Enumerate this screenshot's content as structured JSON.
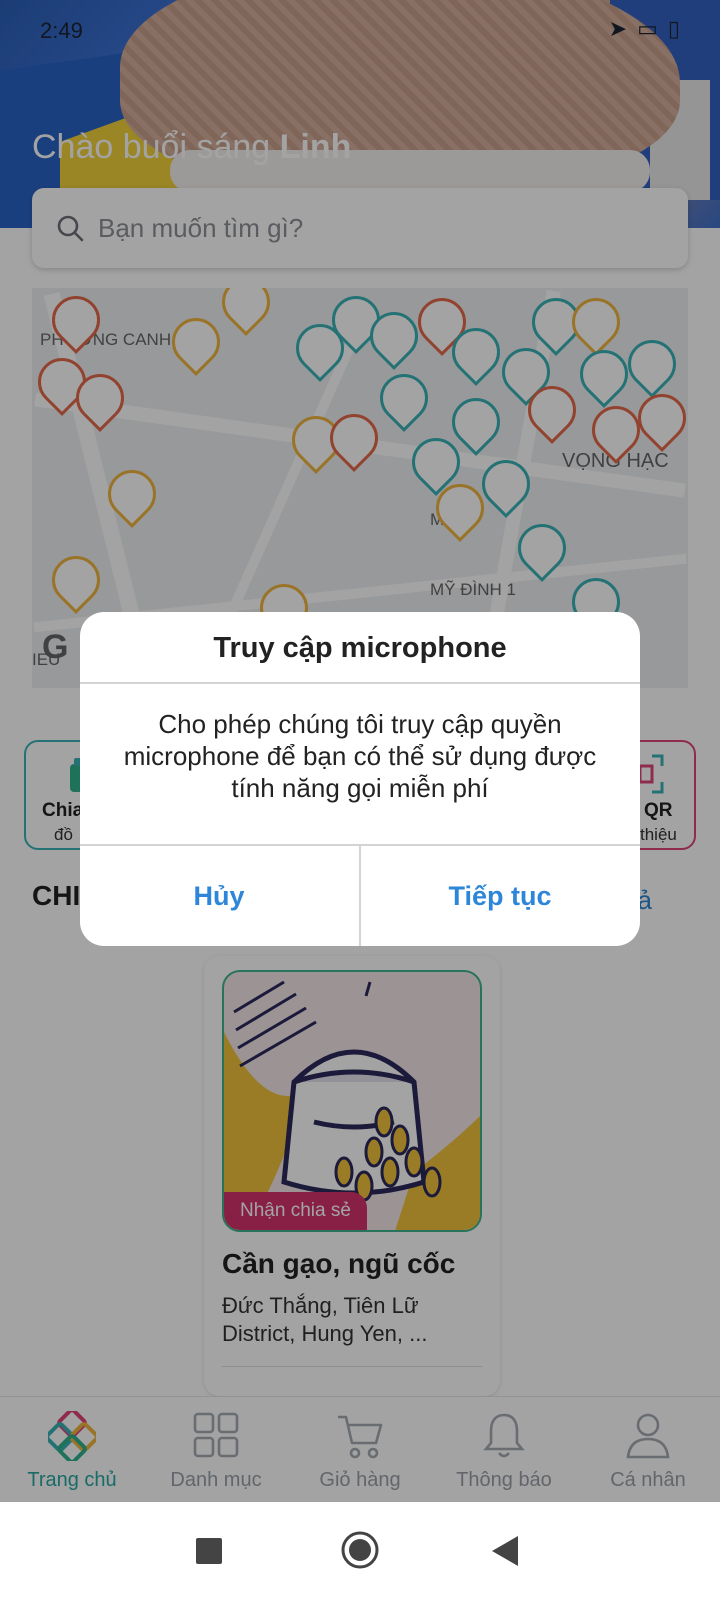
{
  "status_bar": {
    "time": "2:49",
    "icons": [
      "navigation-icon",
      "screen-icon",
      "signal-icon",
      "battery-icon"
    ]
  },
  "header": {
    "greeting_prefix": "Chào buổi sáng",
    "user_name": "Linh"
  },
  "search": {
    "placeholder": "Bạn muốn tìm gì?"
  },
  "map": {
    "labels": [
      "PHƯỜNG CANH",
      "VỌNG HẠC",
      "MỸ ĐÌNH 1",
      "M"
    ],
    "watermark": "G",
    "corner_label": "IEU"
  },
  "categories": [
    {
      "title": "Chia",
      "subtitle": "đồ"
    },
    {
      "title": "QR",
      "subtitle": "thiệu"
    }
  ],
  "section": {
    "title": "CHI",
    "see_all": "t cả"
  },
  "product": {
    "tag": "Nhận chia sẻ",
    "name": "Cần gạo, ngũ cốc",
    "address": "Đức Thắng, Tiên Lữ District, Hung Yen, ..."
  },
  "bottom_nav": [
    {
      "label": "Trang chủ",
      "icon": "home-logo-icon",
      "active": true
    },
    {
      "label": "Danh mục",
      "icon": "grid-icon",
      "active": false
    },
    {
      "label": "Giỏ hàng",
      "icon": "cart-icon",
      "active": false
    },
    {
      "label": "Thông báo",
      "icon": "bell-icon",
      "active": false
    },
    {
      "label": "Cá nhân",
      "icon": "person-icon",
      "active": false
    }
  ],
  "dialog": {
    "title": "Truy cập microphone",
    "message": "Cho phép chúng tôi truy cập quyền microphone để bạn có thể sử dụng được tính năng gọi miễn phí",
    "cancel_label": "Hủy",
    "continue_label": "Tiếp tục"
  },
  "colors": {
    "accent": "#2e86d8",
    "brand_teal": "#27a8a2",
    "tag_pink": "#d5336c"
  }
}
